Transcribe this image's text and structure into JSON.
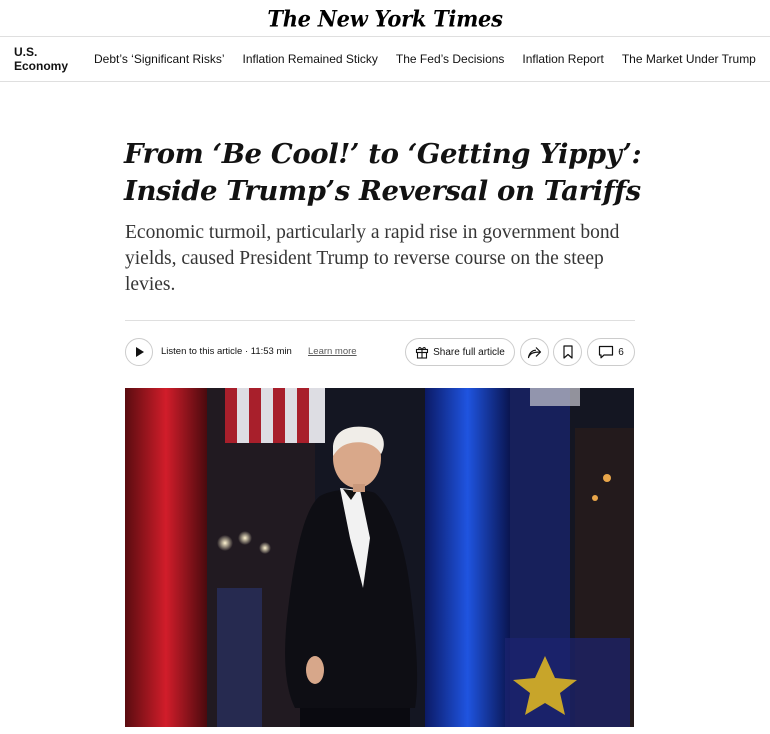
{
  "masthead": {
    "logo_text": "The New York Times"
  },
  "subnav": {
    "section": "U.S. Economy",
    "links": [
      "Debt’s ‘Significant Risks’",
      "Inflation Remained Sticky",
      "The Fed’s Decisions",
      "Inflation Report",
      "The Market Under Trump"
    ]
  },
  "article": {
    "headline_line1": "From ‘Be Cool!’ to ‘Getting Yippy’:",
    "headline_line2": "Inside Trump’s Reversal on Tariffs",
    "summary": "Economic turmoil, particularly a rapid rise in government bond yields, caused President Trump to reverse course on the steep levies."
  },
  "toolbar": {
    "listen_text": "Listen to this article · 11:53 min",
    "learn_more": "Learn more",
    "share_full_label": "Share full article",
    "comment_count": "6",
    "icons": {
      "play": "play-icon",
      "gift": "gift-icon",
      "share": "share-arrow-icon",
      "bookmark": "bookmark-icon",
      "comment": "comment-icon"
    }
  },
  "colors": {
    "text": "#121212",
    "border": "#dfdfdf",
    "pill_border": "#cccccc",
    "summary_text": "#363636"
  }
}
